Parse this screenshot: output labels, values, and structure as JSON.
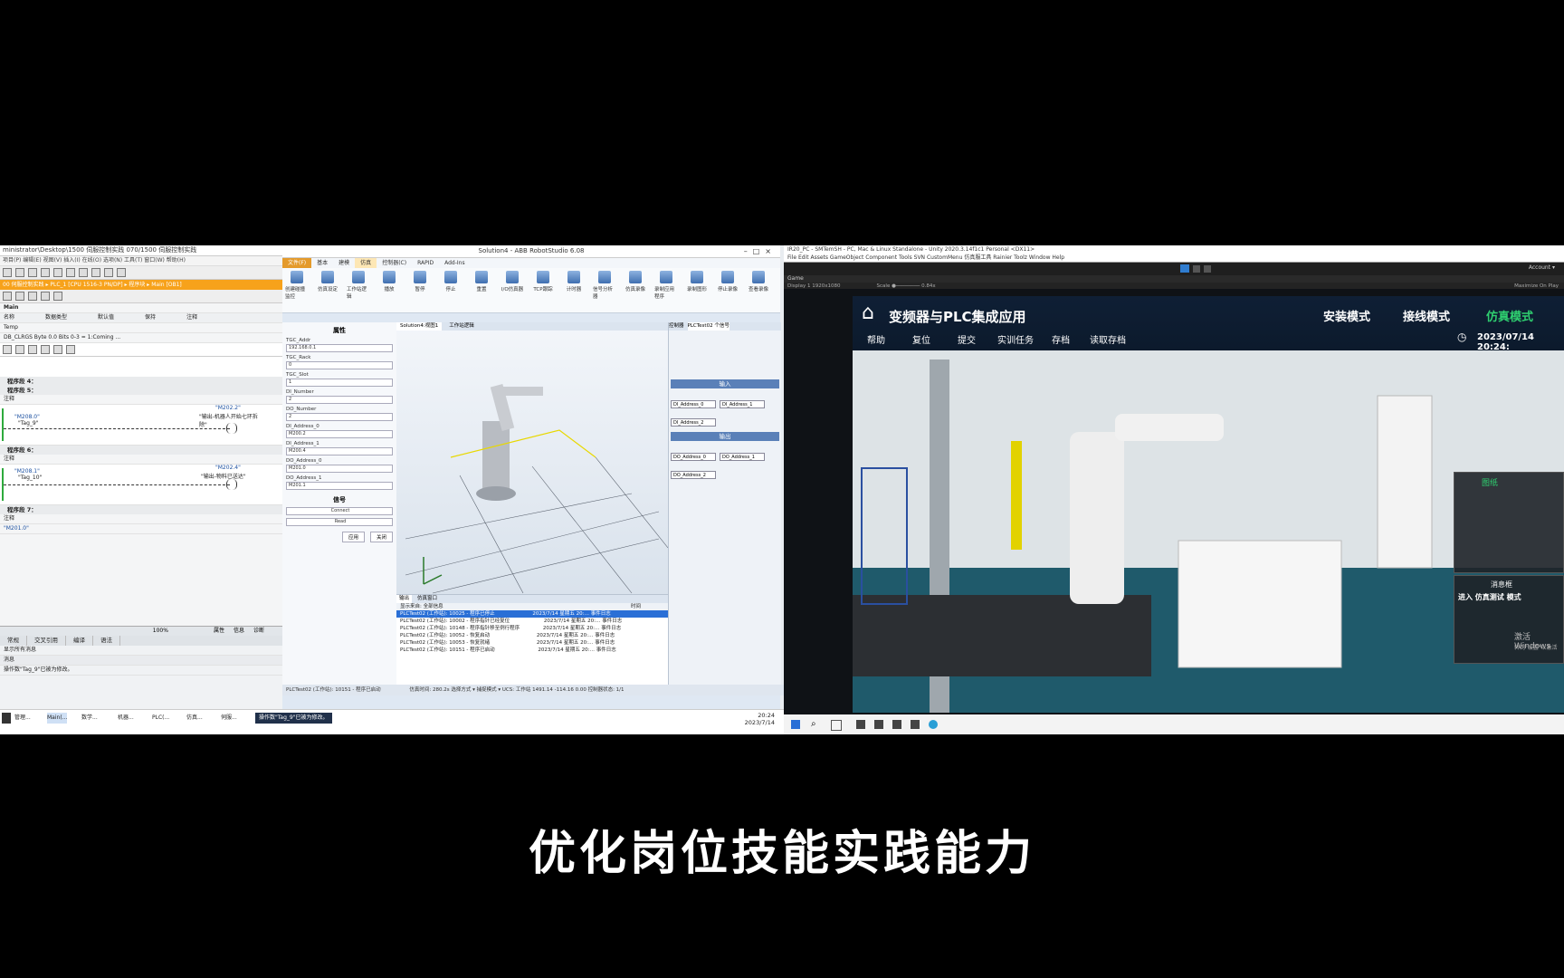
{
  "plc": {
    "title": "ministrator\\Desktop\\1500 伺服控制实践 070/1500 伺服控制实践",
    "menu": "项目(P)   编辑(E)   视图(V)   插入(I)   在线(O)   选项(N)   工具(T)   窗口(W)   帮助(H)",
    "breadcrumb": "00 伺服控制实践 ▸ PLC_1 [CPU 1516-3 PN/DP] ▸ 程序块 ▸ Main [OB1]",
    "block_name": "Main",
    "iface_headers": [
      "名称",
      "数据类型",
      "默认值",
      "保持",
      "注释"
    ],
    "iface_rows": [
      "Temp",
      "DB_CLRGS   Byte   0.0   Bits 0-3 = 1:Coming ..."
    ],
    "segments": [
      {
        "title": "程序段 4：",
        "comment": ""
      },
      {
        "title": "程序段 5：",
        "comment": "注释",
        "contact": "\"M208.0\"",
        "tag": "\"Tag_9\"",
        "coil": "\"M202.2\"",
        "coil_note": "\"输出-机器人开始七环拆除\""
      },
      {
        "title": "程序段 6：",
        "comment": "注释",
        "contact": "\"M208.1\"",
        "tag": "\"Tag_10\"",
        "coil": "\"M202.4\"",
        "coil_note": "\"输出-物料已送达\""
      },
      {
        "title": "程序段 7：",
        "comment": "注释",
        "contact": "\"M201.0\""
      }
    ],
    "zoom": "100%",
    "bottom_tabs": [
      "常规",
      "交叉引用",
      "编译",
      "语法"
    ],
    "inspect_tabs": [
      "属性",
      "信息",
      "诊断"
    ],
    "bottom_filter": "显示所有消息",
    "message_header": "消息",
    "message": "操作数\"Tag_9\"已被为修改。"
  },
  "robotstudio": {
    "title": "Solution4 - ABB RobotStudio 6.08",
    "ribbon_tabs": [
      "文件(F)",
      "基本",
      "建模",
      "仿真",
      "控制器(C)",
      "RAPID",
      "Add-Ins"
    ],
    "active_tab": "仿真",
    "ribbon_buttons": [
      "创建碰撞监控",
      "仿真设定",
      "工作站逻辑",
      "播放",
      "暂停",
      "停止",
      "重置",
      "I/O仿真器",
      "TCP跟踪",
      "计时器",
      "信号分析器",
      "仿真录像",
      "录制应用程序",
      "录制图形",
      "停止录像",
      "查看录像"
    ],
    "left_header": "属性",
    "left_fields": [
      {
        "label": "TGC_Addr",
        "value": "192.168.0.1"
      },
      {
        "label": "TGC_Rack",
        "value": "0"
      },
      {
        "label": "TGC_Slot",
        "value": "1"
      },
      {
        "label": "DI_Number",
        "value": "2"
      },
      {
        "label": "DO_Number",
        "value": "2"
      },
      {
        "label": "DI_Address_0",
        "value": "M200.2"
      },
      {
        "label": "DI_Address_1",
        "value": "M200.4"
      },
      {
        "label": "DO_Address_0",
        "value": "M201.0"
      },
      {
        "label": "DO_Address_1",
        "value": "M201.1"
      }
    ],
    "signal_header": "信号",
    "connect_btn": "Connect",
    "read_btn": "Read",
    "apply_btn": "应用",
    "close_btn": "关闭",
    "view_tabs": [
      "Solution4:视图1",
      "工作站逻辑"
    ],
    "right_tabs": [
      "控制器",
      "PLCTest02 个信号"
    ],
    "right_input": "输入",
    "right_output": "输出",
    "di_signals": [
      "DI_Address_0",
      "DI_Address_1",
      "DI_Address_2"
    ],
    "do_signals": [
      "DO_Address_0",
      "DO_Address_1",
      "DO_Address_2"
    ],
    "output_tabs": [
      "输出",
      "仿真窗口"
    ],
    "output_filter": "显示来自: 全部信息",
    "output_headers": [
      "时间",
      "种类"
    ],
    "output_rows": [
      {
        "text": "PLCTest02 (工作站): 10025 - 程序已停止",
        "time": "2023/7/14 星期五 20:…",
        "type": "事件日志",
        "selected": true
      },
      {
        "text": "PLCTest02 (工作站): 10002 - 程序指针已经复位",
        "time": "2023/7/14 星期五 20:…",
        "type": "事件日志",
        "selected": false
      },
      {
        "text": "PLCTest02 (工作站): 10148 - 程序指针移至例行程序",
        "time": "2023/7/14 星期五 20:…",
        "type": "事件日志",
        "selected": false
      },
      {
        "text": "PLCTest02 (工作站): 10052 - 恢复启动",
        "time": "2023/7/14 星期五 20:…",
        "type": "事件日志",
        "selected": false
      },
      {
        "text": "PLCTest02 (工作站): 10053 - 恢复就绪",
        "time": "2023/7/14 星期五 20:…",
        "type": "事件日志",
        "selected": false
      },
      {
        "text": "PLCTest02 (工作站): 10151 - 程序已启动",
        "time": "2023/7/14 星期五 20:…",
        "type": "事件日志",
        "selected": false
      }
    ],
    "status": "PLCTest02 (工作站): 10151 - 程序已启动",
    "status_right": "仿真时间: 280.2s   选择方式 ▾   捕捉模式 ▾   UCS: 工作站   1491.14  -114.16  0.00   控制器状态: 1/1"
  },
  "taskbar_left": {
    "items": [
      "管理...",
      "Main(...",
      "数学...",
      "机器...",
      "PLC(...",
      "仿真...",
      "伺服..."
    ],
    "notice": "操作数\"Tag_9\"已被为修改。",
    "time": "20:24",
    "date": "2023/7/14"
  },
  "unity": {
    "title": "IR20_PC - SMTemSH - PC, Mac & Linux Standalone - Unity 2020.3.14f1c1 Personal <DX11>",
    "menu": "File   Edit   Assets   GameObject   Component   Tools   SVN   CustomMenu   仿真服工具   Rainier   Toolz   Window   Help",
    "game_tab": "Game",
    "display": "Display 1    1920x1080",
    "scale": "Scale ●──────── 0.84x",
    "maximize": "Maximize On Play",
    "account": "Account ▾",
    "sim_title": "变频器与PLC集成应用",
    "modes": [
      "安装模式",
      "接线模式",
      "仿真模式"
    ],
    "menu_items": [
      "帮助",
      "复位",
      "提交",
      "实训任务",
      "存档",
      "读取存档"
    ],
    "date": "2023/07/14  20:24:",
    "drawing": "图纸",
    "msg_box": "消息框",
    "msg_text": "进入 仿真测试 模式",
    "activate": "激活 Windows",
    "activate_sub": "转到\"设置\"以激活"
  },
  "subtitle": "优化岗位技能实践能力",
  "colors": {
    "plc_orange": "#f7a21b",
    "sim_green": "#2fd070",
    "rs_blue": "#2a6fd6"
  }
}
